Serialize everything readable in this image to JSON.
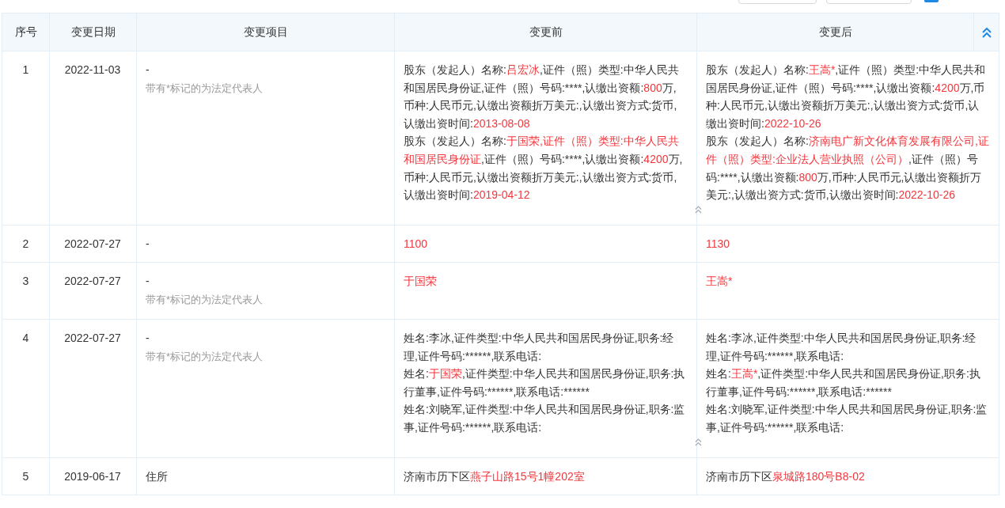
{
  "columns": [
    "序号",
    "变更日期",
    "变更项目",
    "变更前",
    "变更后"
  ],
  "rows": [
    {
      "index": "1",
      "date": "2022-11-03",
      "item": "-",
      "note": "带有*标记的为法定代表人",
      "collapse_toggle": true,
      "before": [
        [
          {
            "text": "股东（发起人）名称:",
            "highlighted": false
          },
          {
            "text": "吕宏冰",
            "highlighted": true
          },
          {
            "text": ",证件（照）类型:中华人民共和国居民身份证,证件（照）号码:****,认缴出资额:",
            "highlighted": false
          },
          {
            "text": "800",
            "highlighted": true
          },
          {
            "text": "万,币种:人民币元,认缴出资额折万美元:,认缴出资方式:货币,认缴出资时间:",
            "highlighted": false
          },
          {
            "text": "2013-08-08",
            "highlighted": true
          }
        ],
        [
          {
            "text": "股东（发起人）名称:",
            "highlighted": false
          },
          {
            "text": "于国荣,证件（照）类型:中华人民共和国居民身份证",
            "highlighted": true
          },
          {
            "text": ",证件（照）号码:****,认缴出资额:",
            "highlighted": false
          },
          {
            "text": "4200",
            "highlighted": true
          },
          {
            "text": "万,币种:人民币元,认缴出资额折万美元:,认缴出资方式:货币,认缴出资时间:",
            "highlighted": false
          },
          {
            "text": "2019-04-12",
            "highlighted": true
          }
        ]
      ],
      "after": [
        [
          {
            "text": "股东（发起人）名称:",
            "highlighted": false
          },
          {
            "text": "王嵩*",
            "highlighted": true
          },
          {
            "text": ",证件（照）类型:中华人民共和国居民身份证,证件（照）号码:****,认缴出资额:",
            "highlighted": false
          },
          {
            "text": "4200",
            "highlighted": true
          },
          {
            "text": "万,币种:人民币元,认缴出资额折万美元:,认缴出资方式:货币,认缴出资时间:",
            "highlighted": false
          },
          {
            "text": "2022-10-26",
            "highlighted": true
          }
        ],
        [
          {
            "text": "股东（发起人）名称:",
            "highlighted": false
          },
          {
            "text": "济南电广新文化体育发展有限公司,证件（照）类型:企业法人营业执照（公司）",
            "highlighted": true
          },
          {
            "text": ",证件（照）号码:****,认缴出资额:",
            "highlighted": false
          },
          {
            "text": "800",
            "highlighted": true
          },
          {
            "text": "万,币种:人民币元,认缴出资额折万美元:,认缴出资方式:货币,认缴出资时间:",
            "highlighted": false
          },
          {
            "text": "2022-10-26",
            "highlighted": true
          }
        ]
      ]
    },
    {
      "index": "2",
      "date": "2022-07-27",
      "item": "-",
      "collapse_toggle": false,
      "before": [
        [
          {
            "text": "1100",
            "highlighted": true
          }
        ]
      ],
      "after": [
        [
          {
            "text": "1130",
            "highlighted": true
          }
        ]
      ]
    },
    {
      "index": "3",
      "date": "2022-07-27",
      "item": "-",
      "note": "带有*标记的为法定代表人",
      "collapse_toggle": false,
      "before": [
        [
          {
            "text": "于国荣",
            "highlighted": true
          }
        ]
      ],
      "after": [
        [
          {
            "text": "王嵩*",
            "highlighted": true
          }
        ]
      ]
    },
    {
      "index": "4",
      "date": "2022-07-27",
      "item": "-",
      "note": "带有*标记的为法定代表人",
      "collapse_toggle": true,
      "before": [
        [
          {
            "text": "姓名:李冰,证件类型:中华人民共和国居民身份证,职务:经理,证件号码:******,联系电话:",
            "highlighted": false
          }
        ],
        [
          {
            "text": "姓名:",
            "highlighted": false
          },
          {
            "text": "于国荣",
            "highlighted": true
          },
          {
            "text": ",证件类型:中华人民共和国居民身份证,职务:执行董事,证件号码:******,联系电话:******",
            "highlighted": false
          }
        ],
        [
          {
            "text": "姓名:刘晓军,证件类型:中华人民共和国居民身份证,职务:监事,证件号码:******,联系电话:",
            "highlighted": false
          }
        ]
      ],
      "after": [
        [
          {
            "text": "姓名:李冰,证件类型:中华人民共和国居民身份证,职务:经理,证件号码:******,联系电话:",
            "highlighted": false
          }
        ],
        [
          {
            "text": "姓名:",
            "highlighted": false
          },
          {
            "text": "王嵩*",
            "highlighted": true
          },
          {
            "text": ",证件类型:中华人民共和国居民身份证,职务:执行董事,证件号码:******,联系电话:******",
            "highlighted": false
          }
        ],
        [
          {
            "text": "姓名:刘晓军,证件类型:中华人民共和国居民身份证,职务:监事,证件号码:******,联系电话:",
            "highlighted": false
          }
        ]
      ]
    },
    {
      "index": "5",
      "date": "2019-06-17",
      "item": "住所",
      "collapse_toggle": false,
      "before": [
        [
          {
            "text": "济南市历下区",
            "highlighted": false
          },
          {
            "text": "燕子山路15号1幢202室",
            "highlighted": true
          }
        ]
      ],
      "after": [
        [
          {
            "text": "济南市历下区",
            "highlighted": false
          },
          {
            "text": "泉城路180号B8-02",
            "highlighted": true
          }
        ]
      ]
    }
  ]
}
